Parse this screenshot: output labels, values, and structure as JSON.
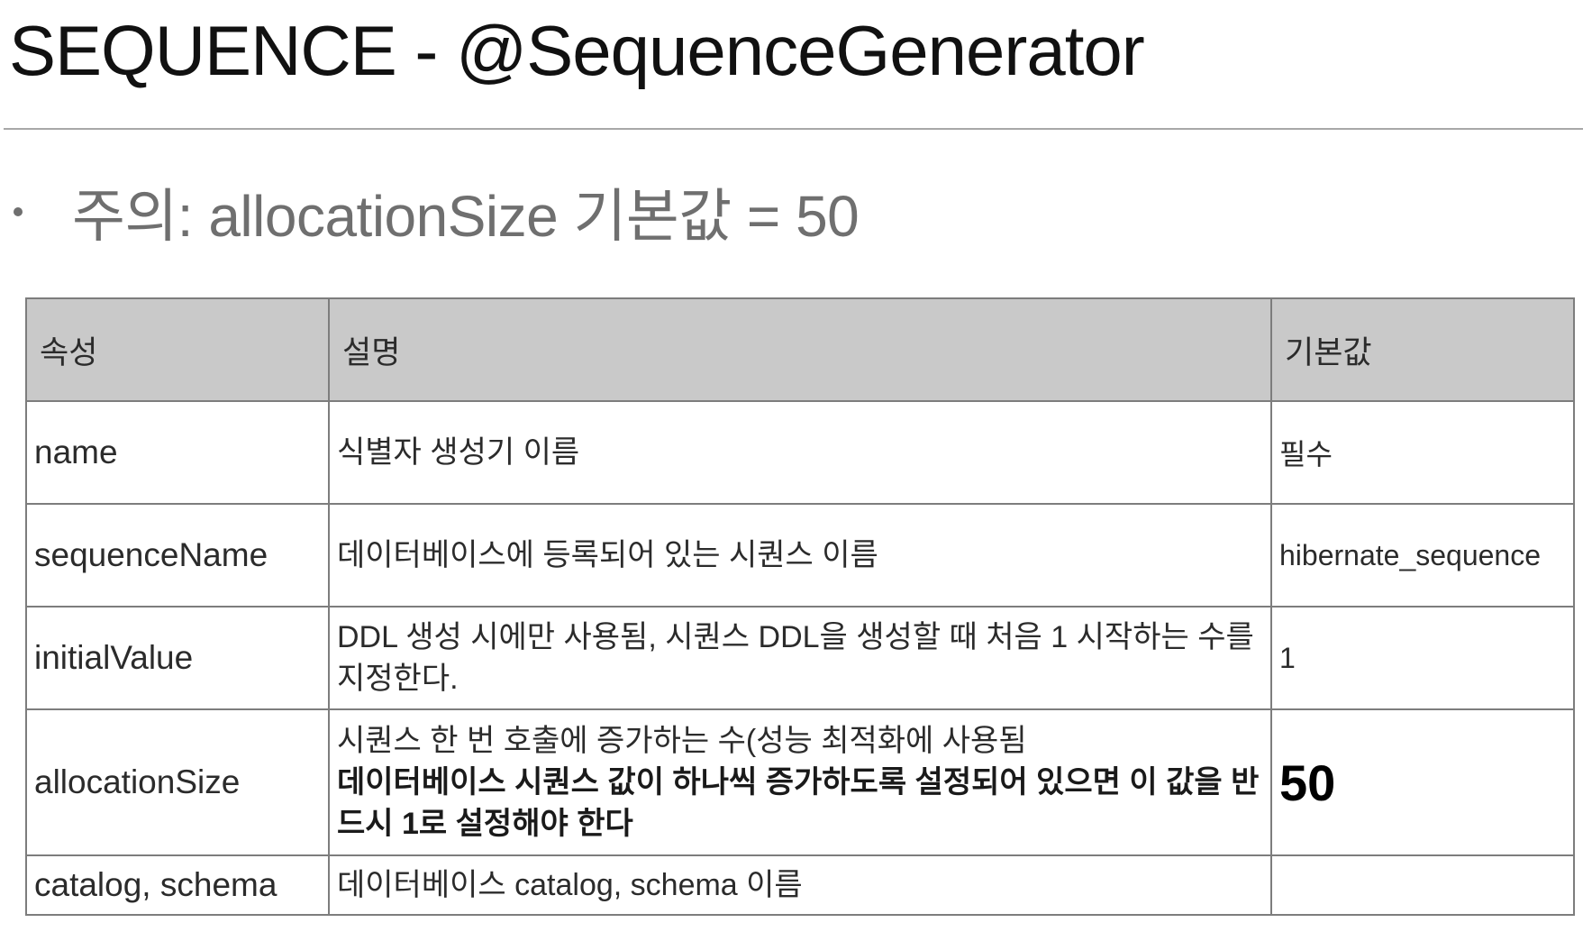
{
  "slide": {
    "title": "SEQUENCE - @SequenceGenerator",
    "bullet": "주의: allocationSize 기본값 = 50"
  },
  "table": {
    "headers": [
      "속성",
      "설명",
      "기본값"
    ],
    "rows": [
      {
        "attribute": "name",
        "description": "식별자 생성기 이름",
        "default": "필수"
      },
      {
        "attribute": "sequenceName",
        "description": "데이터베이스에 등록되어 있는 시퀀스 이름",
        "default": "hibernate_sequence"
      },
      {
        "attribute": "initialValue",
        "description": "DDL 생성 시에만 사용됨, 시퀀스 DDL을 생성할 때 처음 1 시작하는 수를 지정한다.",
        "default": "1"
      },
      {
        "attribute": "allocationSize",
        "description": "시퀀스 한 번 호출에 증가하는 수(성능 최적화에 사용됨",
        "description_bold": "데이터베이스 시퀀스 값이 하나씩 증가하도록 설정되어 있으면 이 값을 반드시 1로 설정해야 한다",
        "default": "50"
      },
      {
        "attribute": "catalog, schema",
        "description": "데이터베이스 catalog, schema 이름",
        "default": ""
      }
    ]
  }
}
